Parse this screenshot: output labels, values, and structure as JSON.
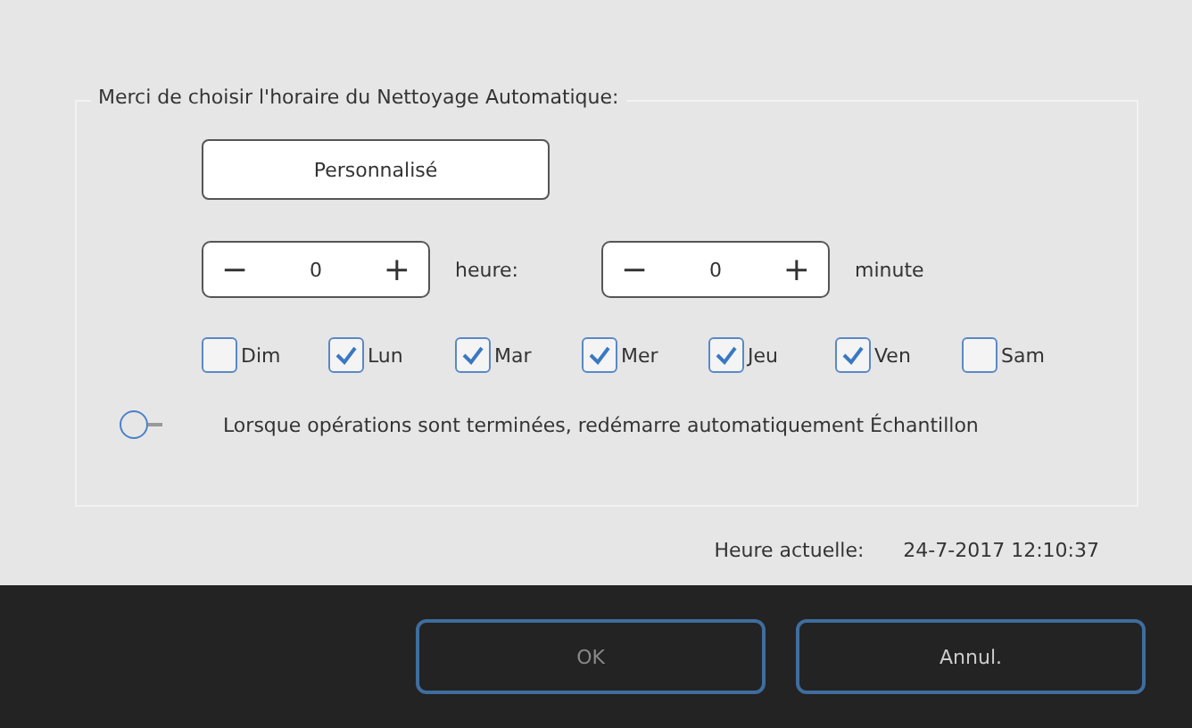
{
  "schedule": {
    "legend": "Merci de choisir l'horaire du Nettoyage Automatique:",
    "mode_button": "Personnalisé",
    "spinners": [
      {
        "minus": "−",
        "value": "0",
        "plus": "+",
        "unit": "heure:"
      },
      {
        "minus": "−",
        "value": "0",
        "plus": "+",
        "unit": "minute"
      }
    ],
    "days": [
      {
        "label": "Dim",
        "checked": false
      },
      {
        "label": "Lun",
        "checked": true
      },
      {
        "label": "Mar",
        "checked": true
      },
      {
        "label": "Mer",
        "checked": true
      },
      {
        "label": "Jeu",
        "checked": true
      },
      {
        "label": "Ven",
        "checked": true
      },
      {
        "label": "Sam",
        "checked": false
      }
    ],
    "restart": {
      "on": false,
      "label": "Lorsque opérations sont terminées, redémarre automatiquement Échantillon"
    }
  },
  "current_time": {
    "label": "Heure actuelle:",
    "value": "24-7-2017 12:10:37"
  },
  "buttons": [
    {
      "label": "OK",
      "disabled": true
    },
    {
      "label": "Annul.",
      "disabled": false
    }
  ]
}
